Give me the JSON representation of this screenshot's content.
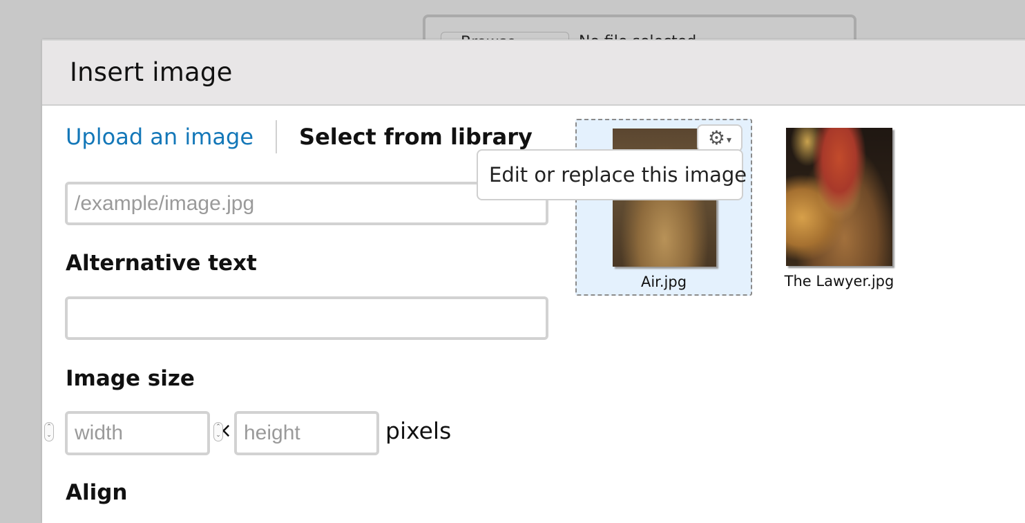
{
  "background_page": {
    "browse_button_label": "Browse...",
    "no_file_text": "No file selected."
  },
  "dialog": {
    "title": "Insert image",
    "tabs": [
      {
        "label": "Upload an image",
        "active": false
      },
      {
        "label": "Select from library",
        "active": true
      }
    ],
    "url_field": {
      "placeholder": "/example/image.jpg",
      "value": ""
    },
    "alt_text": {
      "label": "Alternative text",
      "value": ""
    },
    "image_size": {
      "label": "Image size",
      "width_placeholder": "width",
      "height_placeholder": "height",
      "times_symbol": "×",
      "unit_label": "pixels"
    },
    "align": {
      "label": "Align"
    }
  },
  "library": {
    "items": [
      {
        "caption": "Air.jpg",
        "selected": true
      },
      {
        "caption": "The Lawyer.jpg",
        "selected": false
      }
    ],
    "item_menu": {
      "icon": "gear-icon",
      "caret": "▾"
    },
    "tooltip": "Edit or replace this image"
  },
  "colors": {
    "link": "#1377b8",
    "selected_bg": "#e4f1fd",
    "header_bg": "#e8e6e7"
  }
}
